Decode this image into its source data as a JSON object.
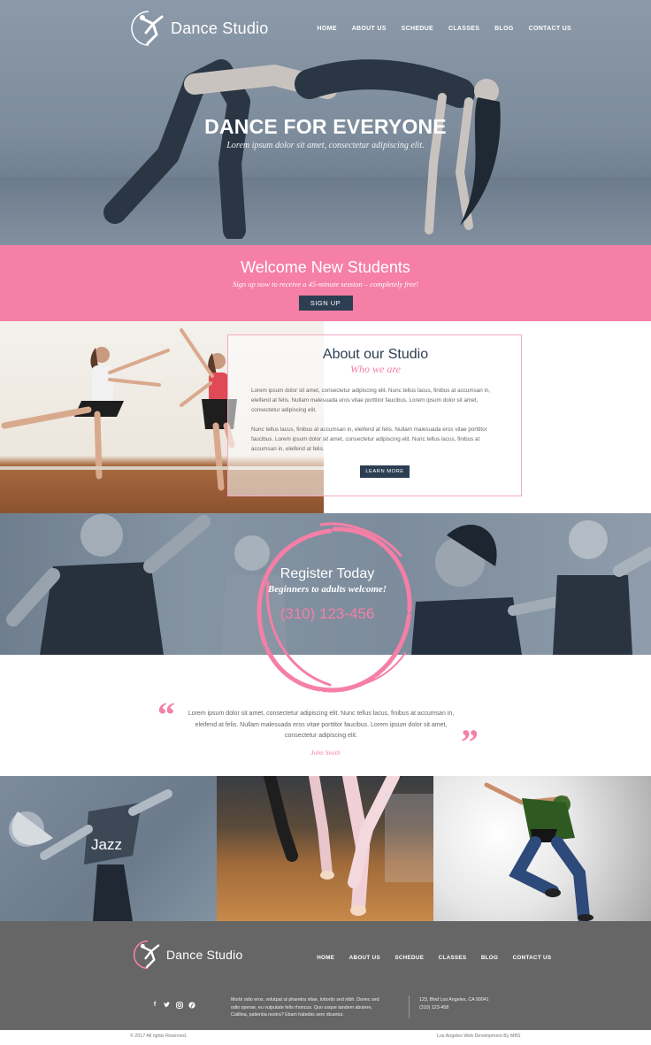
{
  "brand": {
    "name": "Dance Studio"
  },
  "nav": {
    "items": [
      {
        "label": "HOME"
      },
      {
        "label": "ABOUT US"
      },
      {
        "label": "SCHEDUE"
      },
      {
        "label": "CLASSES"
      },
      {
        "label": "BLOG"
      },
      {
        "label": "CONTACT US"
      }
    ]
  },
  "hero": {
    "title": "DANCE FOR EVERYONE",
    "subtitle": "Lorem ipsum dolor sit amet, consectetur adipiscing elit."
  },
  "welcome": {
    "title": "Welcome New Students",
    "subtitle": "Sign up now to receive a 45-minute session – completely free!",
    "button": "SIGN UP"
  },
  "about": {
    "title": "About our Studio",
    "subtitle": "Who we are",
    "paragraph1": "Lorem ipsum dolor sit amet, consectetur adipiscing elit. Nunc tellus lacus, finibus at accumsan in, eleifend at felis. Nullam malesuada eros vitae porttitor faucibus. Lorem ipsum dolor sit amet, consectetur adipiscing elit.",
    "paragraph2": "Nunc tellus lacus, finibus at accumsan in, eleifend at felis. Nullam malesuada eros vitae porttitor faucibus. Lorem ipsum dolor sit amet, consectetur adipiscing elit. Nunc tellus lacus, finibus at accumsan in, eleifend at felis.",
    "button": "LEARN MORE"
  },
  "register": {
    "title": "Register Today",
    "subtitle": "Beginners to adults welcome!",
    "phone": "(310) 123-456"
  },
  "testimonial": {
    "text": "Lorem ipsum dolor sit amet, consectetur adipiscing elit. Nunc tellus lacus, finibus at accumsan in, eleifend at felis. Nullam malesuada eros vitae porttitor faucibus. Lorem ipsum dolor sit amet, consectetur adipiscing elit.",
    "author": "John Smith"
  },
  "classes": {
    "items": [
      {
        "label": "Jazz"
      },
      {
        "label": ""
      },
      {
        "label": ""
      }
    ]
  },
  "footer": {
    "text": "Morbi odio eros, volutpat ut pharetra vitae, lobortis sed nibh. Donec sed odio operae, eu vulputate felis rhoncus. Quo usque tandem abutere, Catilina, patientia nostra? Etiam habebis sem dicantur.",
    "address": "123, Blvd Los Angeles, CA 90041",
    "phone": "(310) 123-458",
    "copyright": "© 2017 All rights Reserved.",
    "credit": "Los Angeles Web Development By MBS",
    "social": [
      "facebook-icon",
      "twitter-icon",
      "instagram-icon",
      "pinterest-icon"
    ]
  },
  "colors": {
    "accent_pink": "#f57fa6",
    "dark_navy": "#2c3e52",
    "slate": "#7d8c9c",
    "footer_gray": "#666666"
  }
}
